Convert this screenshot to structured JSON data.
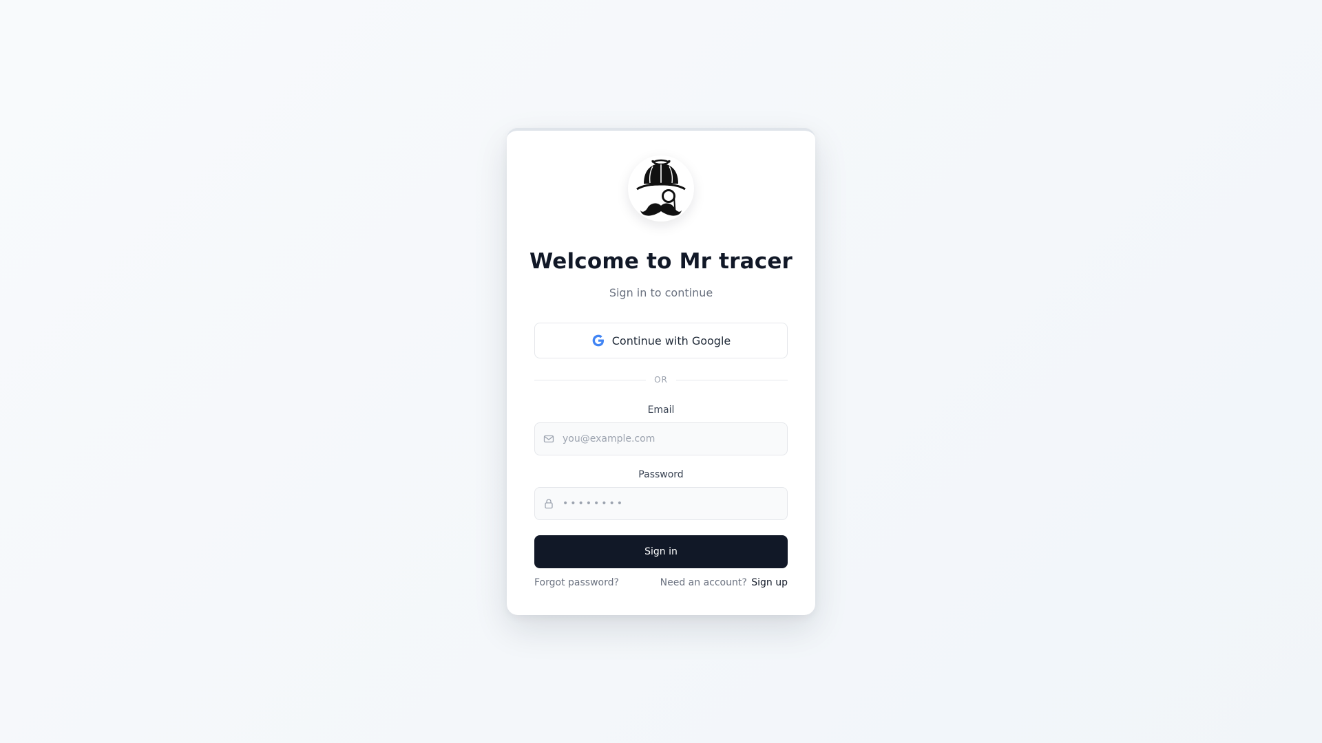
{
  "brand": {
    "title": "Welcome to Mr tracer",
    "subtitle": "Sign in to continue",
    "logo_icon": "detective-mascot-icon"
  },
  "auth": {
    "google_button_label": "Continue with Google",
    "google_icon": "google-g-icon",
    "divider_text": "OR",
    "email": {
      "label": "Email",
      "placeholder": "you@example.com",
      "value": "",
      "icon": "mail-icon"
    },
    "password": {
      "label": "Password",
      "placeholder": "••••••••",
      "value": "",
      "icon": "lock-icon"
    },
    "submit_label": "Sign in",
    "forgot_password_label": "Forgot password?",
    "signup_prompt": "Need an account?",
    "signup_link_label": "Sign up"
  },
  "colors": {
    "primary": "#111827",
    "google_blue": "#4285F4",
    "muted_text": "#6b7280",
    "border": "#e5e7eb",
    "background": "#f8fafc"
  }
}
